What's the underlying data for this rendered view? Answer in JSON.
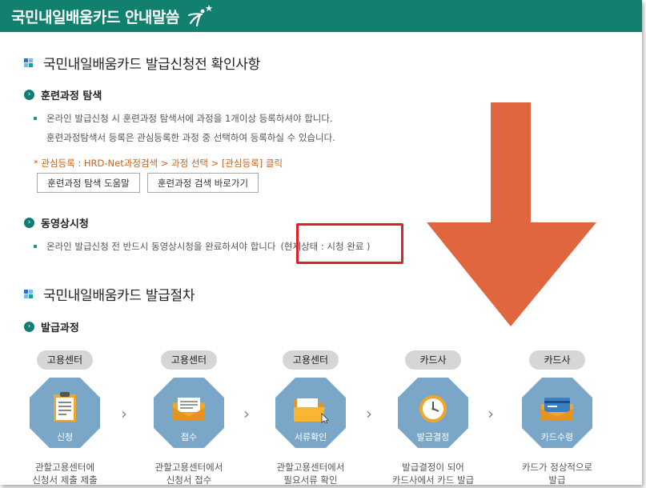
{
  "title": "국민내일배움카드 안내말씀",
  "section1": {
    "heading": "국민내일배움카드 발급신청전 확인사항",
    "sub1": {
      "heading": "훈련과정 탐색",
      "line1": "온라인 발급신청 시 훈련과정 탐색서에 과정을 1개이상 등록하셔야 합니다.",
      "line2": "훈련과정탐색서 등록은 관심등록한 과정 중 선택하여 등록하실 수 있습니다.",
      "note": "* 관심등록 : HRD-Net과정검색 > 과정 선택 > [관심등록] 클릭",
      "btn_help": "훈련과정 탐색 도움말",
      "btn_search": "훈련과정 검색 바로가기"
    },
    "sub2": {
      "heading": "동영상시청",
      "line1": "온라인 발급신청 전 반드시 동영상시청을 완료하셔야 합니다",
      "status": "(현재상태 : 시청 완료 )"
    }
  },
  "section2": {
    "heading": "국민내일배움카드 발급절차",
    "sub1": {
      "heading": "발급과정"
    },
    "steps": [
      {
        "agency": "고용센터",
        "label": "신청",
        "desc1": "관할고용센터에",
        "desc2": "신청서 제출 제출"
      },
      {
        "agency": "고용센터",
        "label": "접수",
        "desc1": "관할고용센터에서",
        "desc2": "신청서 접수"
      },
      {
        "agency": "고용센터",
        "label": "서류확인",
        "desc1": "관할고용센터에서",
        "desc2": "필요서류 확인"
      },
      {
        "agency": "카드사",
        "label": "발급결정",
        "desc1": "발급결정이 되어",
        "desc2": "카드사에서 카드 발급"
      },
      {
        "agency": "카드사",
        "label": "카드수령",
        "desc1": "카드가 정상적으로",
        "desc2": "발급"
      }
    ]
  },
  "colors": {
    "header": "#11806e",
    "octagon": "#7aa7c7",
    "arrow": "#e0663f",
    "highlight": "#e0202a"
  },
  "icons": {
    "logo": "star-person-icon",
    "step1": "clipboard-icon",
    "step2": "envelope-icon",
    "step3": "folder-icon",
    "step4": "clock-icon",
    "step5": "card-icon"
  }
}
